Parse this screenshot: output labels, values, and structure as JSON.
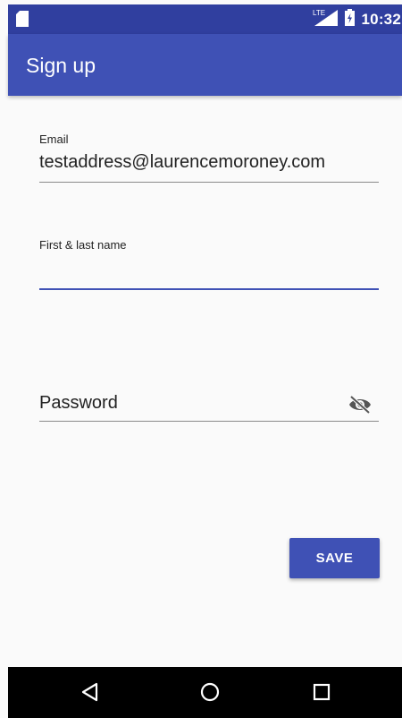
{
  "status_bar": {
    "time": "10:32",
    "network": "LTE",
    "icons": [
      "sd-card-icon",
      "lte-signal-icon",
      "battery-icon"
    ]
  },
  "app_bar": {
    "title": "Sign up"
  },
  "form": {
    "email": {
      "label": "Email",
      "value": "testaddress@laurencemoroney.com"
    },
    "name": {
      "label": "First & last name",
      "value": "",
      "focused": true
    },
    "password": {
      "placeholder": "Password",
      "toggle_icon": "visibility-off-icon"
    }
  },
  "save_button": {
    "label": "SAVE"
  },
  "nav_bar": {
    "icons": [
      "back-icon",
      "home-icon",
      "recents-icon"
    ]
  },
  "colors": {
    "primary": "#3f51b5",
    "primary_dark": "#303f9f",
    "background": "#fafafa"
  }
}
